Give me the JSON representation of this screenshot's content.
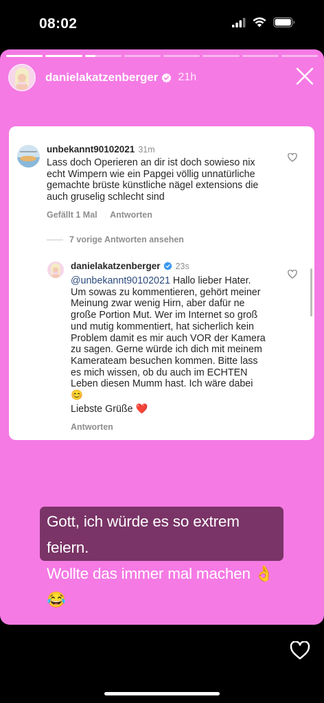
{
  "status_bar": {
    "time": "08:02"
  },
  "story": {
    "progress": [
      1,
      1,
      0.3,
      0,
      0,
      0,
      0,
      0
    ],
    "username": "danielakatzenberger",
    "time_ago": "21h"
  },
  "comment": {
    "username": "unbekannt90102021",
    "time": "31m",
    "lines": [
      "Lass doch Operieren an dir ist doch sowieso nix",
      "echt Wimpern wie ein Papgei völlig unnatürliche",
      "gemachte brüste künstliche nägel  extensions die",
      "auch gruselig schlecht sind"
    ],
    "likes_label": "Gefällt 1 Mal",
    "reply_label": "Antworten",
    "view_replies": "7 vorige Antworten ansehen"
  },
  "reply": {
    "username": "danielakatzenberger",
    "time": "23s",
    "mention": "@unbekannt90102021",
    "line1_rest": " Hallo lieber Hater.",
    "lines": [
      "Um sowas zu kommentieren, gehört meiner",
      "Meinung zwar wenig Hirn, aber dafür ne",
      "große Portion Mut. Wer im Internet so groß",
      "und mutig kommentiert, hat sicherlich kein",
      "Problem damit es mir auch VOR der Kamera",
      "zu sagen. Gerne würde ich dich mit meinem",
      "Kamerateam besuchen kommen. Bitte lass",
      "es mich wissen, ob du auch im ECHTEN",
      "Leben diesen Mumm hast. Ich wäre dabei"
    ],
    "emoji_line": "😊",
    "greeting": "Liebste Grüße",
    "greeting_emoji": "❤️",
    "reply_label": "Antworten"
  },
  "caption": {
    "line1": "Gott, ich würde es so extrem feiern.",
    "line2": "Wollte das immer mal machen 👌😂"
  },
  "colors": {
    "story_background": "#f57ae4",
    "caption_background": "#7a3467",
    "verified_blue": "#3897f0",
    "heart_red": "#e0142b"
  }
}
